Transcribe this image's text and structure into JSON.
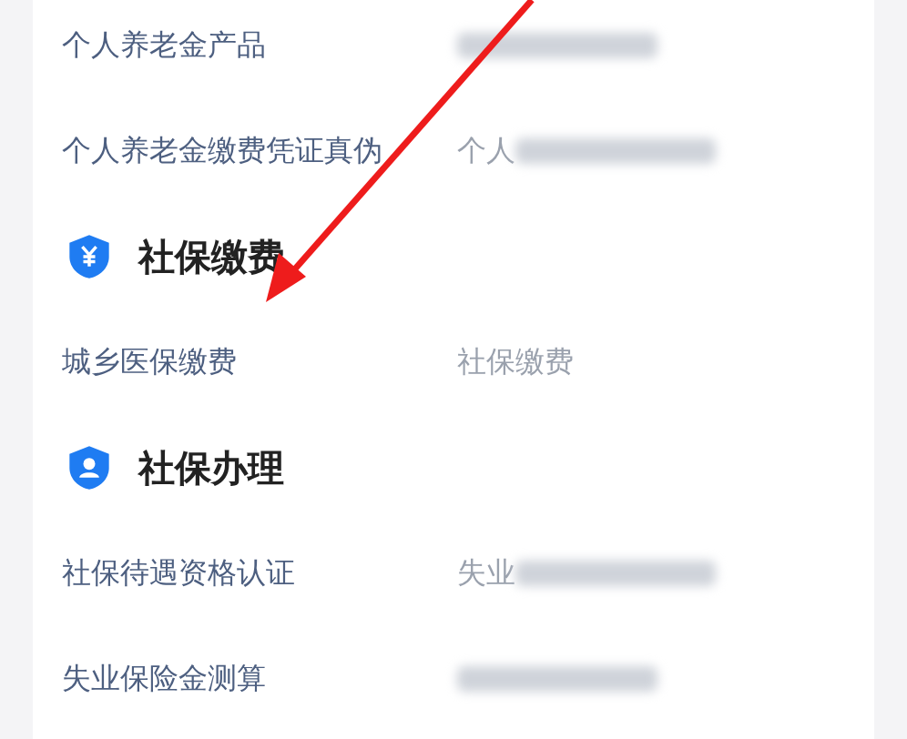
{
  "top_items": [
    {
      "label": "个人养老金产品",
      "detail": {
        "blurred": true
      }
    },
    {
      "label": "个人养老金缴费凭证真伪",
      "detail": {
        "text": "个人",
        "blurred": true
      }
    }
  ],
  "sections": [
    {
      "title": "社保缴费",
      "kind": "yen",
      "items": [
        {
          "label": "城乡医保缴费",
          "detail": {
            "text": "社保缴费",
            "blurred": false
          }
        }
      ]
    },
    {
      "title": "社保办理",
      "kind": "person",
      "items": [
        {
          "label": "社保待遇资格认证",
          "detail": {
            "text": "失业",
            "blurred": true
          }
        },
        {
          "label": "失业保险金测算",
          "detail": {
            "blurred": true
          }
        }
      ]
    }
  ]
}
